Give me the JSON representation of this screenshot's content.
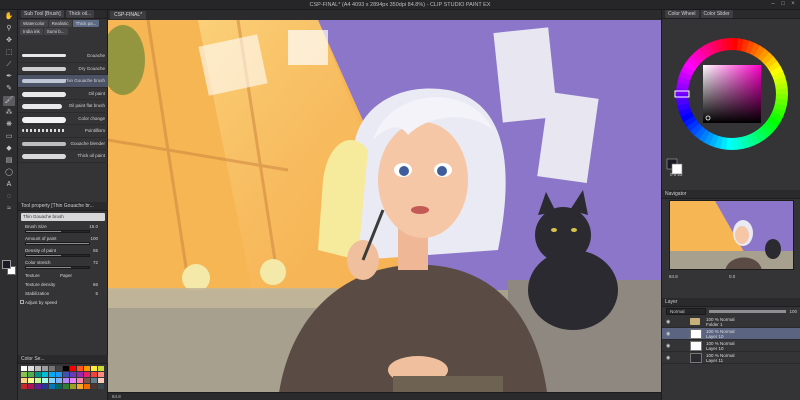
{
  "window": {
    "title": "CSP-FINAL* (A4 4093 x 2894px 350dpi 84.8%) - CLIP STUDIO PAINT EX",
    "controls": [
      "–",
      "□",
      "×"
    ]
  },
  "tools": [
    "hand",
    "zoom",
    "move",
    "select",
    "eyedropper",
    "pen",
    "pencil",
    "brush",
    "airbrush",
    "decoration",
    "eraser",
    "fill",
    "gradient",
    "figure",
    "text",
    "balloon",
    "correct-line"
  ],
  "sub_tool_panel": {
    "header": "Sub Tool [Brush]",
    "header_tab2": "Thick oil...",
    "subtabs": [
      "Watercolor",
      "Realistic",
      "Thick pa...",
      "India ink",
      "Sumi b..."
    ],
    "brushes": [
      {
        "name": "Gouache"
      },
      {
        "name": "Dry Gouache"
      },
      {
        "name": "Thin Gouache brush"
      },
      {
        "name": "Oil paint"
      },
      {
        "name": "Oil paint flat brush"
      },
      {
        "name": "Color change"
      },
      {
        "name": "Pointillism"
      },
      {
        "name": "Gouache blender"
      },
      {
        "name": "Thick oil paint"
      }
    ]
  },
  "tool_property": {
    "header": "Tool property [Thin Gouache br...",
    "banner": "Thin Gouache brush",
    "props": [
      {
        "label": "Brush Size",
        "value": "15.0",
        "fill": 0.55
      },
      {
        "label": "Amount of paint",
        "value": "100",
        "fill": 1.0
      },
      {
        "label": "Density of paint",
        "value": "55",
        "fill": 0.55
      },
      {
        "label": "Color stretch",
        "value": "72",
        "fill": 0.72
      }
    ],
    "texture_label": "Texture",
    "texture_value": "Paper",
    "texture_density_label": "Texture density",
    "texture_density_value": "66",
    "stabilization_label": "Stabilization",
    "stabilization_value": "5",
    "adjust_speed_label": "Adjust by speed"
  },
  "color_set": {
    "header": "Color Se...",
    "colors": [
      "#ffffff",
      "#e0e0e0",
      "#bdbdbd",
      "#9e9e9e",
      "#757575",
      "#424242",
      "#000000",
      "#ff0000",
      "#ff5722",
      "#ff9800",
      "#ffeb3b",
      "#cddc39",
      "#8bc34a",
      "#4caf50",
      "#009688",
      "#00bcd4",
      "#03a9f4",
      "#2196f3",
      "#3f51b5",
      "#673ab7",
      "#9c27b0",
      "#e91e63",
      "#f44336",
      "#ff8a80",
      "#ffd180",
      "#ffff8d",
      "#ccff90",
      "#a7ffeb",
      "#80d8ff",
      "#82b1ff",
      "#b388ff",
      "#ea80fc",
      "#ff80ab",
      "#795548",
      "#607d8b",
      "#ffccbc",
      "#c62828",
      "#ad1457",
      "#6a1b9a",
      "#283593",
      "#0277bd",
      "#00695c",
      "#2e7d32",
      "#9e9d24",
      "#f9a825",
      "#ef6c00",
      "#4e342e",
      "#37474f"
    ]
  },
  "canvas": {
    "tab": "CSP-FINAL*",
    "status": "84.8",
    "art_colors": {
      "wall_yellow": "#f6b653",
      "wall_purple": "#8c76c9",
      "sofa": "#a7a08f",
      "sweater": "#5a4c44",
      "hair": "#eaeaf4",
      "skin": "#f5c7a6",
      "cat": "#2b2a30"
    }
  },
  "color_wheel": {
    "header": "Color Wheel",
    "tab2": "Color Slider",
    "main_color": "#1b1b25",
    "hsv": "0 0 22",
    "hue_marker": "magenta"
  },
  "navigator": {
    "header": "Navigator",
    "zoom": "84.8",
    "rotate": "0.0"
  },
  "layer_panel": {
    "header": "Layer",
    "blend_mode": "Normal",
    "opacity": "100",
    "layers": [
      {
        "line1": "100 % Normal",
        "line2": "Folder 1",
        "type": "folder"
      },
      {
        "line1": "100 % Normal",
        "line2": "Layer 10",
        "type": "layer",
        "active": true
      },
      {
        "line1": "100 % Normal",
        "line2": "Layer 10",
        "type": "layer"
      },
      {
        "line1": "100 % Normal",
        "line2": "Layer 11",
        "type": "layer"
      }
    ]
  }
}
